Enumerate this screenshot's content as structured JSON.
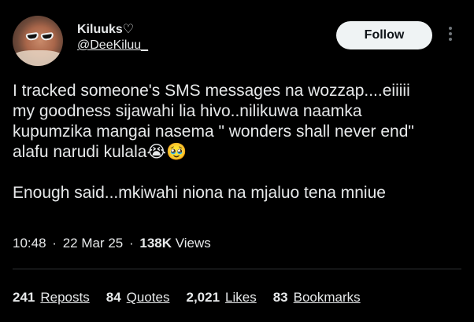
{
  "author": {
    "display_name": "Kiluuks♡",
    "handle": "@DeeKiluu_"
  },
  "follow_label": "Follow",
  "tweet": {
    "text": "I tracked someone's SMS messages na wozzap....eiiiii\nmy goodness sijawahi lia hivo..nilikuwa naamka\nkupumzika mangai nasema \" wonders shall never end\"\nalafu narudi kulala😭🥹\n\nEnough said...mkiwahi niona na mjaluo tena mniue"
  },
  "meta": {
    "time": "10:48",
    "separator": "·",
    "date": "22 Mar 25",
    "views_count": "138K",
    "views_label": "Views"
  },
  "stats": [
    {
      "count": "241",
      "label": "Reposts"
    },
    {
      "count": "84",
      "label": "Quotes"
    },
    {
      "count": "2,021",
      "label": "Likes"
    },
    {
      "count": "83",
      "label": "Bookmarks"
    }
  ]
}
